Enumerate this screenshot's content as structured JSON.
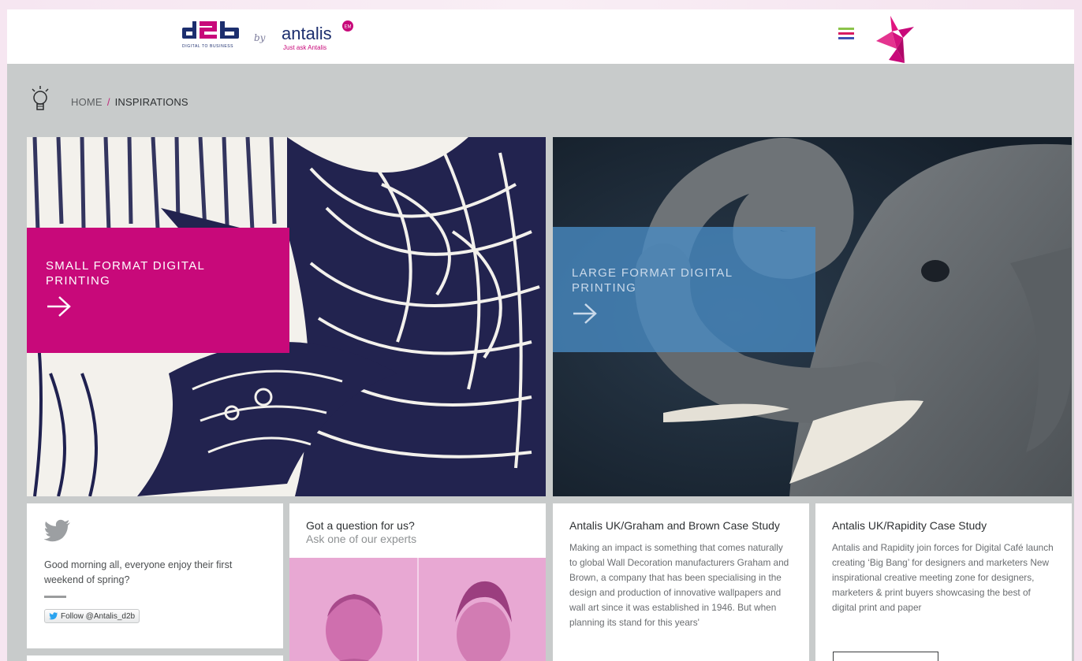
{
  "header": {
    "logo_d2b_tagline": "DIGITAL TO BUSINESS",
    "logo_by": "by",
    "logo_antalis_name": "antalis",
    "logo_antalis_badge": "EM",
    "logo_antalis_tagline": "Just ask Antalis",
    "menu_icon": "hamburger-icon",
    "mascot_icon": "origami-bird-icon"
  },
  "breadcrumb": {
    "home": "HOME",
    "separator": "/",
    "current": "INSPIRATIONS"
  },
  "hero": {
    "left": {
      "title": "SMALL FORMAT DIGITAL PRINTING",
      "arrow_icon": "arrow-right-icon"
    },
    "right": {
      "title": "LARGE FORMAT DIGITAL PRINTING",
      "arrow_icon": "arrow-right-icon"
    }
  },
  "twitter": {
    "icon": "twitter-bird-icon",
    "tweet": "Good morning all, everyone enjoy their first weekend of spring?",
    "follow_label": "Follow @Antalis_d2b"
  },
  "question": {
    "title": "Got a question for us?",
    "subtitle": "Ask one of our experts"
  },
  "case_studies": [
    {
      "title": "Antalis UK/Graham and Brown Case Study",
      "body": "Making an impact is something that comes naturally to global Wall Decoration manufacturers Graham and Brown, a company that has been specialising in the design and production of innovative wallpapers and wall art since it was established in 1946. But when planning its stand for this years'"
    },
    {
      "title": "Antalis UK/Rapidity Case Study",
      "body": "Antalis and Rapidity join forces for Digital Café launch creating ‘Big Bang’ for designers and marketers New inspirational creative meeting zone for designers, marketers & print buyers showcasing the best of digital print and paper"
    }
  ],
  "colors": {
    "brand_magenta": "#c8097a",
    "brand_navy": "#1c2e6e",
    "overlay_blue": "#498cc4",
    "panel_grey": "#c8cbcb",
    "menu_stripes": [
      "#8bc34a",
      "#d81b60",
      "#3f51b5"
    ]
  }
}
